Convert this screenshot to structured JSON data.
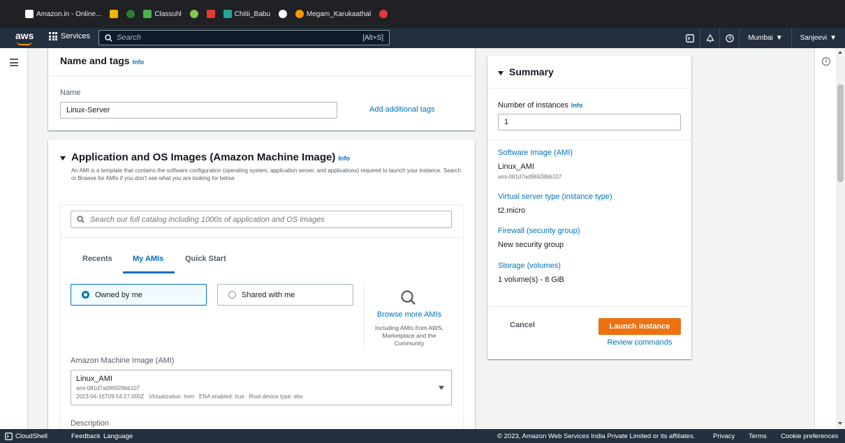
{
  "bookmarks": [
    {
      "label": "Amazon.in - Online...",
      "color": "#ffffff"
    },
    {
      "label": "",
      "color": "#f4b400"
    },
    {
      "label": "",
      "color": "#2e7d32"
    },
    {
      "label": "Classuhl",
      "color": "#4caf50"
    },
    {
      "label": "",
      "color": "#8bc34a"
    },
    {
      "label": "",
      "color": "#e53935"
    },
    {
      "label": "Chitii_Babu",
      "color": "#26a69a"
    },
    {
      "label": "",
      "color": "#ffffff"
    },
    {
      "label": "Megam_Karukaathal",
      "color": "#ff9800"
    },
    {
      "label": "",
      "color": "#e53935"
    }
  ],
  "nav": {
    "logo": "aws",
    "services": "Services",
    "search_placeholder": "Search",
    "search_shortcut": "[Alt+S]",
    "region": "Mumbai",
    "user": "Sanjeevi"
  },
  "name_tags": {
    "title": "Name and tags",
    "info": "Info",
    "name_label": "Name",
    "name_value": "Linux-Server",
    "add_tags": "Add additional tags"
  },
  "ami_section": {
    "title": "Application and OS Images (Amazon Machine Image)",
    "info": "Info",
    "description": "An AMI is a template that contains the software configuration (operating system, application server, and applications) required to launch your instance. Search or Browse for AMIs if you don't see what you are looking for below",
    "search_placeholder": "Search our full catalog including 1000s of application and OS images",
    "tabs": [
      "Recents",
      "My AMIs",
      "Quick Start"
    ],
    "owned_by_me": "Owned by me",
    "shared_with_me": "Shared with me",
    "browse_more": "Browse more AMIs",
    "browse_desc": "Including AMIs from AWS, Marketplace and the Community",
    "ami_label": "Amazon Machine Image (AMI)",
    "ami_name": "Linux_AMI",
    "ami_id": "ami-081d7ad96928bb107",
    "ami_meta": "2023-04-16T09:54:27.000Z   Virtualization: hvm   ENA enabled: true   Root device type: ebs",
    "description_label": "Description"
  },
  "summary": {
    "title": "Summary",
    "instances_label": "Number of instances",
    "info": "Info",
    "instances_value": "1",
    "software_image_label": "Software Image (AMI)",
    "software_image_name": "Linux_AMI",
    "software_image_id": "ami-081d7ad96928bb107",
    "server_type_label": "Virtual server type (instance type)",
    "server_type_value": "t2.micro",
    "firewall_label": "Firewall (security group)",
    "firewall_value": "New security group",
    "storage_label": "Storage (volumes)",
    "storage_value": "1 volume(s) - 8 GiB",
    "cancel": "Cancel",
    "launch": "Launch instance",
    "review": "Review commands"
  },
  "footer": {
    "cloudshell": "CloudShell",
    "feedback": "Feedback",
    "language": "Language",
    "copyright": "© 2023, Amazon Web Services India Private Limited or its affiliates.",
    "privacy": "Privacy",
    "terms": "Terms",
    "cookies": "Cookie preferences"
  },
  "colors": {
    "nav_bg": "#232f3e",
    "link": "#0073bb",
    "launch": "#ec7211"
  }
}
